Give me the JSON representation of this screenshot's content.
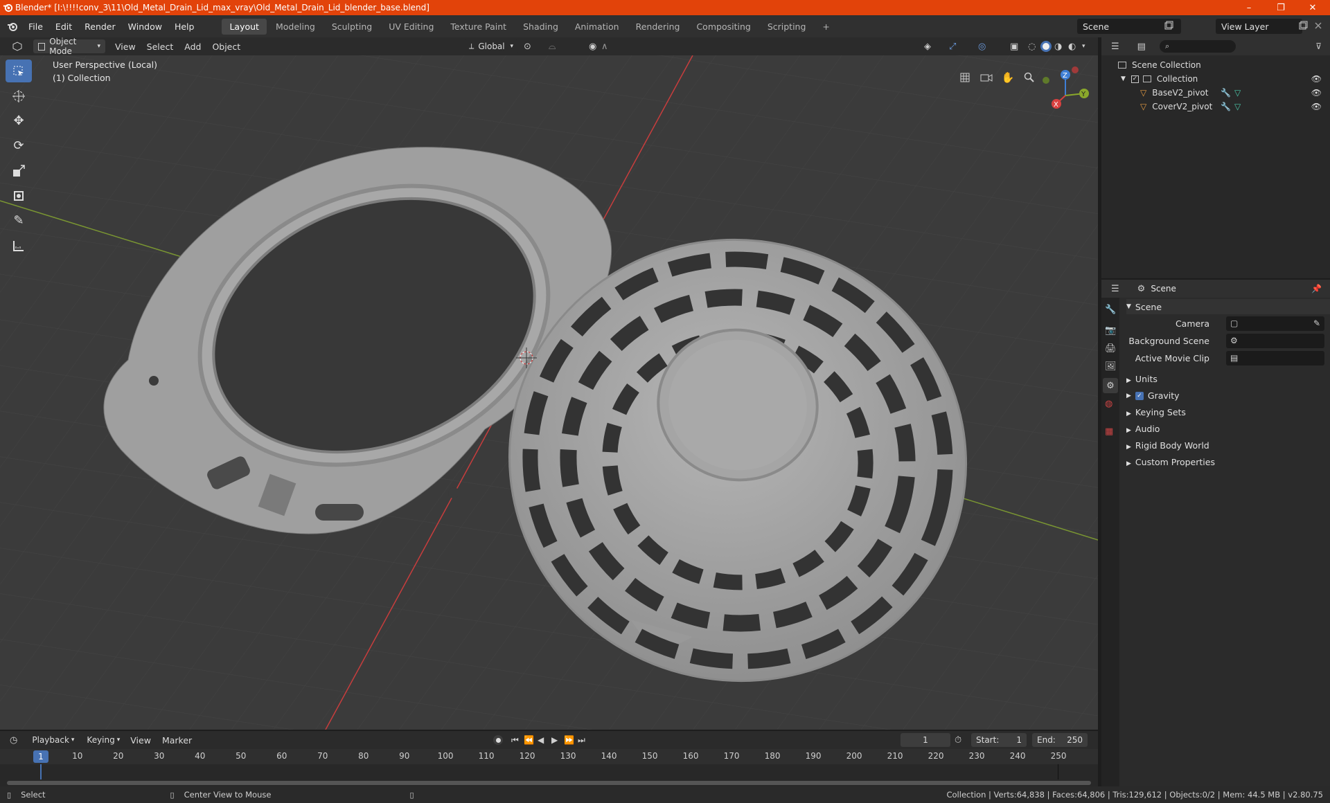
{
  "window": {
    "title": "Blender* [I:\\!!!!conv_3\\11\\Old_Metal_Drain_Lid_max_vray\\Old_Metal_Drain_Lid_blender_base.blend]",
    "minimize": "–",
    "maximize": "❐",
    "close": "✕"
  },
  "menu": {
    "items": [
      "File",
      "Edit",
      "Render",
      "Window",
      "Help"
    ],
    "workspaces": [
      "Layout",
      "Modeling",
      "Sculpting",
      "UV Editing",
      "Texture Paint",
      "Shading",
      "Animation",
      "Rendering",
      "Compositing",
      "Scripting"
    ],
    "active_workspace": "Layout",
    "add_workspace": "+",
    "scene": "Scene",
    "view_layer": "View Layer"
  },
  "viewport_header": {
    "mode": "Object Mode",
    "menus": [
      "View",
      "Select",
      "Add",
      "Object"
    ],
    "orientation": "Global"
  },
  "viewport": {
    "perspective_label": "User Perspective (Local)",
    "collection_label": "(1) Collection",
    "gizmo": {
      "z": "Z",
      "y": "Y",
      "x": "X"
    }
  },
  "outliner": {
    "root": "Scene Collection",
    "collection": "Collection",
    "objects": [
      "BaseV2_pivot",
      "CoverV2_pivot"
    ]
  },
  "properties": {
    "context": "Scene",
    "panel_title": "Scene",
    "camera_label": "Camera",
    "background_scene_label": "Background Scene",
    "movie_clip_label": "Active Movie Clip",
    "sections": [
      "Units",
      "Gravity",
      "Keying Sets",
      "Audio",
      "Rigid Body World",
      "Custom Properties"
    ],
    "gravity_checked": true
  },
  "timeline": {
    "menus": [
      "Playback",
      "Keying",
      "View",
      "Marker"
    ],
    "current_frame": "1",
    "start_label": "Start:",
    "start": "1",
    "end_label": "End:",
    "end": "250",
    "ticks": [
      "10",
      "20",
      "30",
      "40",
      "50",
      "60",
      "70",
      "80",
      "90",
      "100",
      "110",
      "120",
      "130",
      "140",
      "150",
      "160",
      "170",
      "180",
      "190",
      "200",
      "210",
      "220",
      "230",
      "240",
      "250"
    ],
    "playhead": "1"
  },
  "status": {
    "left_action": "Select",
    "middle_action": "Center View to Mouse",
    "stats": "Collection | Verts:64,838 | Faces:64,806 | Tris:129,612 | Objects:0/2 | Mem: 44.5 MB | v2.80.75"
  },
  "colors": {
    "titlebar": "#e2430a",
    "active_tool": "#4772b3",
    "x_axis": "#d8403f",
    "y_axis": "#8aa82b",
    "z_axis": "#3f7fd6",
    "object_orange": "#e49b42"
  }
}
